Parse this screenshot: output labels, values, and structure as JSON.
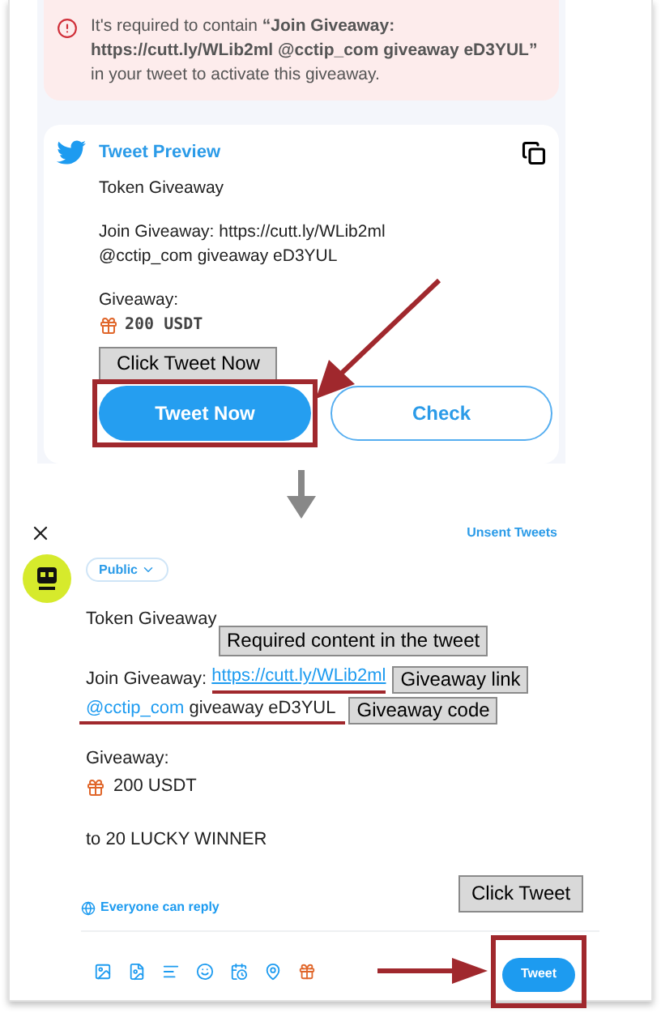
{
  "alert": {
    "text": "It's required to contain **“Join Giveaway: https://cutt.ly/WLib2ml @cctip_com giveaway eD3YUL”** in your tweet to activate this giveaway."
  },
  "preview": {
    "title": "Tweet Preview",
    "heading": "Token Giveaway",
    "body": "Join Giveaway: https://cutt.ly/WLib2ml @cctip_com giveaway eD3YUL",
    "giveaway_label": "Giveaway:",
    "reward": "200 USDT",
    "buttons": [
      {
        "label": "Tweet Now",
        "kind": "primary",
        "highlighted": true
      },
      {
        "label": "Check",
        "kind": "outline",
        "highlighted": false
      }
    ]
  },
  "compose": {
    "header_link": "Unsent Tweets",
    "audience": "Public",
    "heading": "Token Giveaway",
    "join_label": "Join Giveaway:",
    "link": "https://cutt.ly/WLib2ml",
    "mention": "@cctip_com",
    "code_text": "giveaway eD3YUL",
    "giveaway_label": "Giveaway:",
    "reward": "200 USDT",
    "winners": "to 20 LUCKY WINNER",
    "reply_setting": "Everyone can reply",
    "tweet_button": "Tweet"
  },
  "annotations": {
    "tweet_now": "Click Tweet Now",
    "required": "Required content in the tweet",
    "link": "Giveaway link",
    "code": "Giveaway code",
    "tweet": "Click Tweet"
  }
}
